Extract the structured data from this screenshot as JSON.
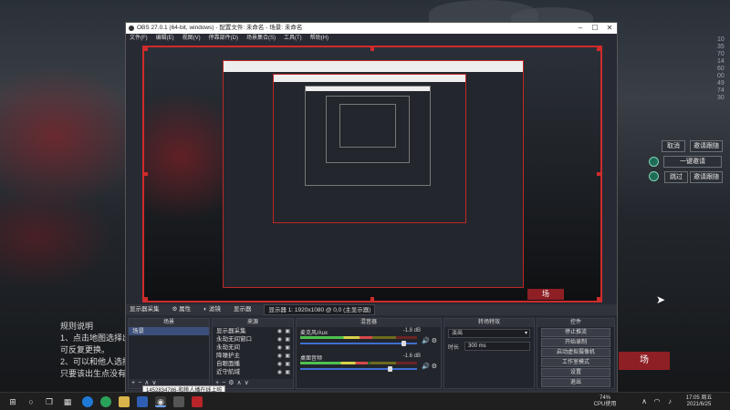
{
  "desktop": {
    "instructions_title": "规则说明",
    "instructions": [
      "1、点击地图选择出生",
      "可反复更换。",
      "2、可以和他人选择同",
      "只要该出生点没有达"
    ],
    "vertical_id": "103570146000497430",
    "overlay_buttons": {
      "cancel": "取消",
      "invite": "邀请跟随",
      "one_click": "一键邀请",
      "pass": "跳过",
      "invite2": "邀请跟随"
    },
    "banner_text": "场"
  },
  "obs": {
    "title": "OBS 27.0.1 (64-bit, windows) - 配置文件: 未命名 - 场景: 未命名",
    "menu": [
      "文件(F)",
      "编辑(E)",
      "视图(V)",
      "停靠部件(D)",
      "场景集合(S)",
      "工具(T)",
      "帮助(H)"
    ],
    "dock_bar": {
      "source_name": "显示器采集",
      "properties": "属性",
      "filters": "滤镜",
      "display_label": "显示器",
      "display_value": "显示器 1: 1920x1080 @ 0,0 (主显示器)"
    },
    "scenes": {
      "title": "场景",
      "items": [
        "场景"
      ]
    },
    "sources": {
      "title": "来源",
      "items": [
        "显示器采集",
        "永劫无间窗口",
        "永劫无间",
        "降噪护主",
        "自眼面播",
        "近守航域"
      ]
    },
    "mixer": {
      "title": "混音器",
      "channels": [
        {
          "name": "麦克风/Aux",
          "db": "-1.8 dB"
        },
        {
          "name": "桌面音频",
          "db": "-1.6 dB"
        }
      ]
    },
    "transitions": {
      "title": "转场特效",
      "type": "淡出",
      "duration_label": "时长",
      "duration": "300 ms"
    },
    "controls": {
      "title": "控件",
      "buttons": [
        "停止推流",
        "开始录制",
        "启动虚拟摄像机",
        "工作室模式",
        "设置",
        "退出"
      ]
    }
  },
  "taskbar": {
    "tooltip": "1452834786-和桃人播在线上啦",
    "battery": "74%",
    "cpu": "CPU使用",
    "time": "17:05 周五",
    "date": "2021/6/25"
  },
  "colors": {
    "accent_red": "#cf2b2b",
    "obs_bg": "#272a33",
    "selected": "#3c4e7a"
  },
  "meters": {
    "mic_level": 0.62,
    "desktop_level": 0.58,
    "mic_fader": 0.9,
    "desktop_fader": 0.78
  }
}
